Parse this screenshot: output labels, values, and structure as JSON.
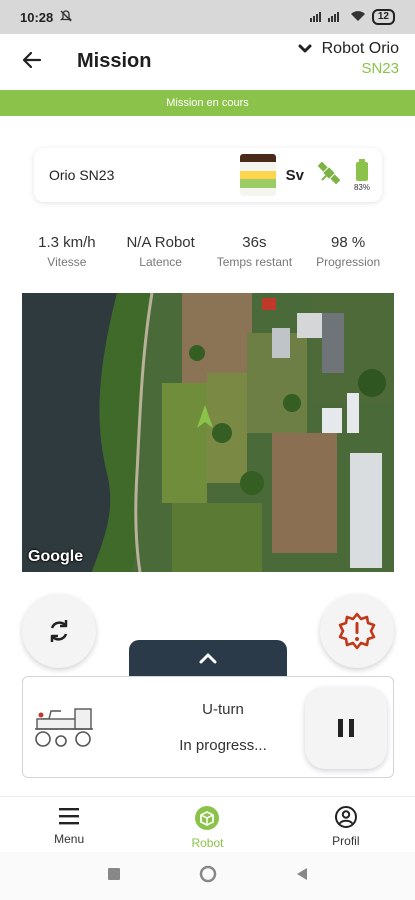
{
  "status_bar": {
    "time": "10:28",
    "battery": "12"
  },
  "header": {
    "title": "Mission",
    "robot_name": "Robot Orio",
    "robot_serial": "SN23"
  },
  "banner": {
    "text": "Mission en cours"
  },
  "robot_card": {
    "name": "Orio SN23",
    "signal": "Sv",
    "battery_pct": "83%",
    "colors": {
      "accent": "#8bc34a"
    }
  },
  "stats": [
    {
      "value": "1.3 km/h",
      "label": "Vitesse"
    },
    {
      "value": "N/A Robot",
      "label": "Latence"
    },
    {
      "value": "36s",
      "label": "Temps restant"
    },
    {
      "value": "98 %",
      "label": "Progression"
    }
  ],
  "map": {
    "attribution": "Google"
  },
  "action": {
    "name": "U-turn",
    "status": "In progress..."
  },
  "nav": [
    {
      "label": "Menu",
      "icon": "menu-icon"
    },
    {
      "label": "Robot",
      "icon": "robot-icon"
    },
    {
      "label": "Profil",
      "icon": "profile-icon"
    }
  ]
}
